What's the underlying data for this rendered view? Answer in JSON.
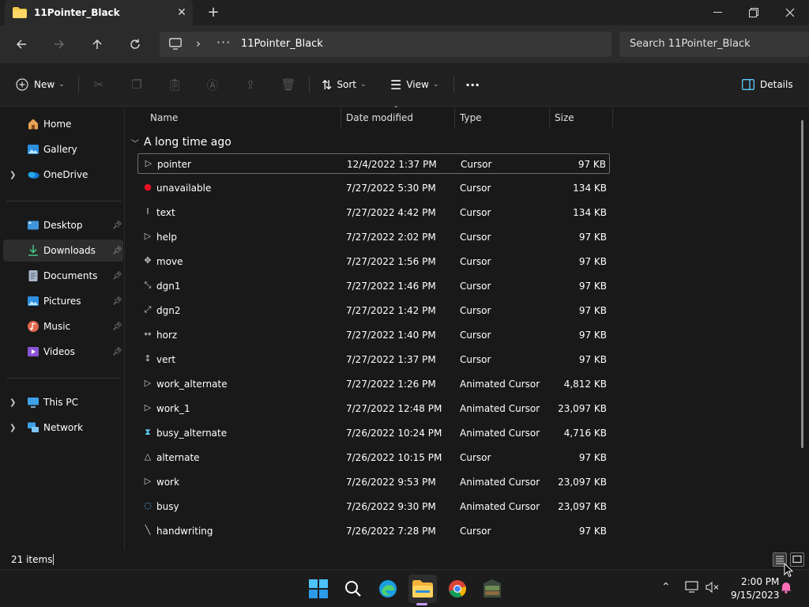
{
  "window": {
    "tab_title": "11Pointer_Black",
    "close_tab": "✕",
    "new_tab": "+"
  },
  "address": {
    "separator": "›",
    "overflow": "···",
    "path": "11Pointer_Black",
    "search_placeholder": "Search 11Pointer_Black"
  },
  "commands": {
    "new_label": "New",
    "sort_label": "Sort",
    "view_label": "View",
    "more_label": "···",
    "details_label": "Details"
  },
  "sidebar": {
    "items": [
      {
        "label": "Home",
        "icon": "home-icon"
      },
      {
        "label": "Gallery",
        "icon": "gallery-icon"
      },
      {
        "label": "OneDrive",
        "icon": "onedrive-icon"
      },
      {
        "label": "Desktop",
        "icon": "desktop-icon"
      },
      {
        "label": "Downloads",
        "icon": "downloads-icon"
      },
      {
        "label": "Documents",
        "icon": "documents-icon"
      },
      {
        "label": "Pictures",
        "icon": "pictures-icon"
      },
      {
        "label": "Music",
        "icon": "music-icon"
      },
      {
        "label": "Videos",
        "icon": "videos-icon"
      },
      {
        "label": "This PC",
        "icon": "this-pc-icon"
      },
      {
        "label": "Network",
        "icon": "network-icon"
      }
    ]
  },
  "columns": {
    "name": "Name",
    "date": "Date modified",
    "type": "Type",
    "size": "Size"
  },
  "group": {
    "label": "A long time ago"
  },
  "files": [
    {
      "name": "pointer",
      "date": "12/4/2022 1:37 PM",
      "type": "Cursor",
      "size": "97 KB",
      "glyph": "▷"
    },
    {
      "name": "unavailable",
      "date": "7/27/2022 5:30 PM",
      "type": "Cursor",
      "size": "134 KB",
      "glyph": "●"
    },
    {
      "name": "text",
      "date": "7/27/2022 4:42 PM",
      "type": "Cursor",
      "size": "134 KB",
      "glyph": "I"
    },
    {
      "name": "help",
      "date": "7/27/2022 2:02 PM",
      "type": "Cursor",
      "size": "97 KB",
      "glyph": "▷"
    },
    {
      "name": "move",
      "date": "7/27/2022 1:56 PM",
      "type": "Cursor",
      "size": "97 KB",
      "glyph": "✥"
    },
    {
      "name": "dgn1",
      "date": "7/27/2022 1:46 PM",
      "type": "Cursor",
      "size": "97 KB",
      "glyph": "⤡"
    },
    {
      "name": "dgn2",
      "date": "7/27/2022 1:42 PM",
      "type": "Cursor",
      "size": "97 KB",
      "glyph": "⤢"
    },
    {
      "name": "horz",
      "date": "7/27/2022 1:40 PM",
      "type": "Cursor",
      "size": "97 KB",
      "glyph": "↔"
    },
    {
      "name": "vert",
      "date": "7/27/2022 1:37 PM",
      "type": "Cursor",
      "size": "97 KB",
      "glyph": "↕"
    },
    {
      "name": "work_alternate",
      "date": "7/27/2022 1:26 PM",
      "type": "Animated Cursor",
      "size": "4,812 KB",
      "glyph": "▷"
    },
    {
      "name": "work_1",
      "date": "7/27/2022 12:48 PM",
      "type": "Animated Cursor",
      "size": "23,097 KB",
      "glyph": "▷"
    },
    {
      "name": "busy_alternate",
      "date": "7/26/2022 10:24 PM",
      "type": "Animated Cursor",
      "size": "4,716 KB",
      "glyph": "⧗"
    },
    {
      "name": "alternate",
      "date": "7/26/2022 10:15 PM",
      "type": "Cursor",
      "size": "97 KB",
      "glyph": "△"
    },
    {
      "name": "work",
      "date": "7/26/2022 9:53 PM",
      "type": "Animated Cursor",
      "size": "23,097 KB",
      "glyph": "▷"
    },
    {
      "name": "busy",
      "date": "7/26/2022 9:30 PM",
      "type": "Animated Cursor",
      "size": "23,097 KB",
      "glyph": "◌"
    },
    {
      "name": "handwriting",
      "date": "7/26/2022 7:28 PM",
      "type": "Cursor",
      "size": "97 KB",
      "glyph": "╲"
    }
  ],
  "status": {
    "count": "21 items"
  },
  "clock": {
    "time": "2:00 PM",
    "date": "9/15/2023"
  },
  "colors": {
    "accent": "#60cdff",
    "folder": "#f2c94c",
    "error_red": "#e81123"
  }
}
